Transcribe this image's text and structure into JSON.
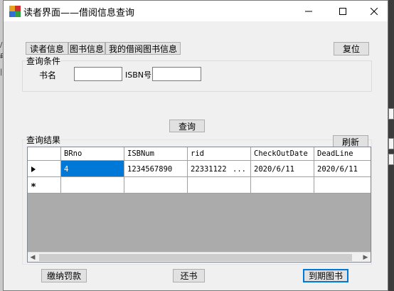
{
  "window": {
    "title": "读者界面——借阅信息查询"
  },
  "tabs": [
    "读者信息",
    "图书信息",
    "我的借阅图书信息"
  ],
  "reset_label": "复位",
  "query_group": {
    "legend": "查询条件",
    "book_name_label": "书名",
    "book_name_value": "",
    "isbn_label": "ISBN号",
    "isbn_value": ""
  },
  "query_button": "查询",
  "result_group": {
    "legend": "查询结果"
  },
  "refresh_label": "刷新",
  "grid": {
    "columns": [
      "BRno",
      "ISBNum",
      "rid",
      "CheckOutDate",
      "DeadLine"
    ],
    "rows": [
      [
        "4",
        "1234567890",
        "22331122",
        "2020/6/11",
        "2020/6/11"
      ]
    ],
    "ellipsis": "..."
  },
  "bottom_buttons": {
    "pay_fine": "缴纳罚款",
    "return_book": "还书",
    "due_books": "到期图书"
  },
  "colors": {
    "selection": "#0078d7",
    "grid_bg": "#ababab"
  }
}
